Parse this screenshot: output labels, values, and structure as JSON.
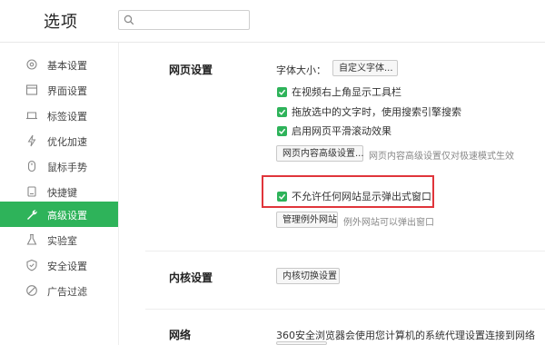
{
  "header": {
    "title": "选项",
    "search": {
      "value": "",
      "placeholder": ""
    }
  },
  "sidebar": {
    "items": [
      {
        "label": "基本设置",
        "icon": "gear-icon"
      },
      {
        "label": "界面设置",
        "icon": "window-icon"
      },
      {
        "label": "标签设置",
        "icon": "tab-icon"
      },
      {
        "label": "优化加速",
        "icon": "lightning-icon"
      },
      {
        "label": "鼠标手势",
        "icon": "mouse-icon"
      },
      {
        "label": "快捷键",
        "icon": "keyboard-icon"
      },
      {
        "label": "高级设置",
        "icon": "wrench-icon",
        "active": true
      },
      {
        "label": "实验室",
        "icon": "flask-icon"
      },
      {
        "label": "安全设置",
        "icon": "shield-icon"
      },
      {
        "label": "广告过滤",
        "icon": "block-icon"
      }
    ]
  },
  "web_settings": {
    "title": "网页设置",
    "font_size_label": "字体大小：",
    "custom_font_button": "自定义字体...",
    "options": [
      {
        "label": "在视频右上角显示工具栏",
        "checked": true
      },
      {
        "label": "拖放选中的文字时，使用搜索引擎搜索",
        "checked": true
      },
      {
        "label": "启用网页平滑滚动效果",
        "checked": true
      }
    ],
    "advanced_content_button": "网页内容高级设置...",
    "advanced_content_hint": "网页内容高级设置仅对极速模式生效",
    "popup_option": {
      "label": "不允许任何网站显示弹出式窗口",
      "checked": true
    },
    "manage_exceptions_button": "管理例外网站",
    "manage_exceptions_hint": "例外网站可以弹出窗口"
  },
  "kernel_settings": {
    "title": "内核设置",
    "switch_button": "内核切换设置"
  },
  "network": {
    "title": "网络",
    "description": "360安全浏览器会使用您计算机的系统代理设置连接到网络"
  },
  "colors": {
    "accent": "#2eb35a",
    "highlight": "#e0353b"
  }
}
